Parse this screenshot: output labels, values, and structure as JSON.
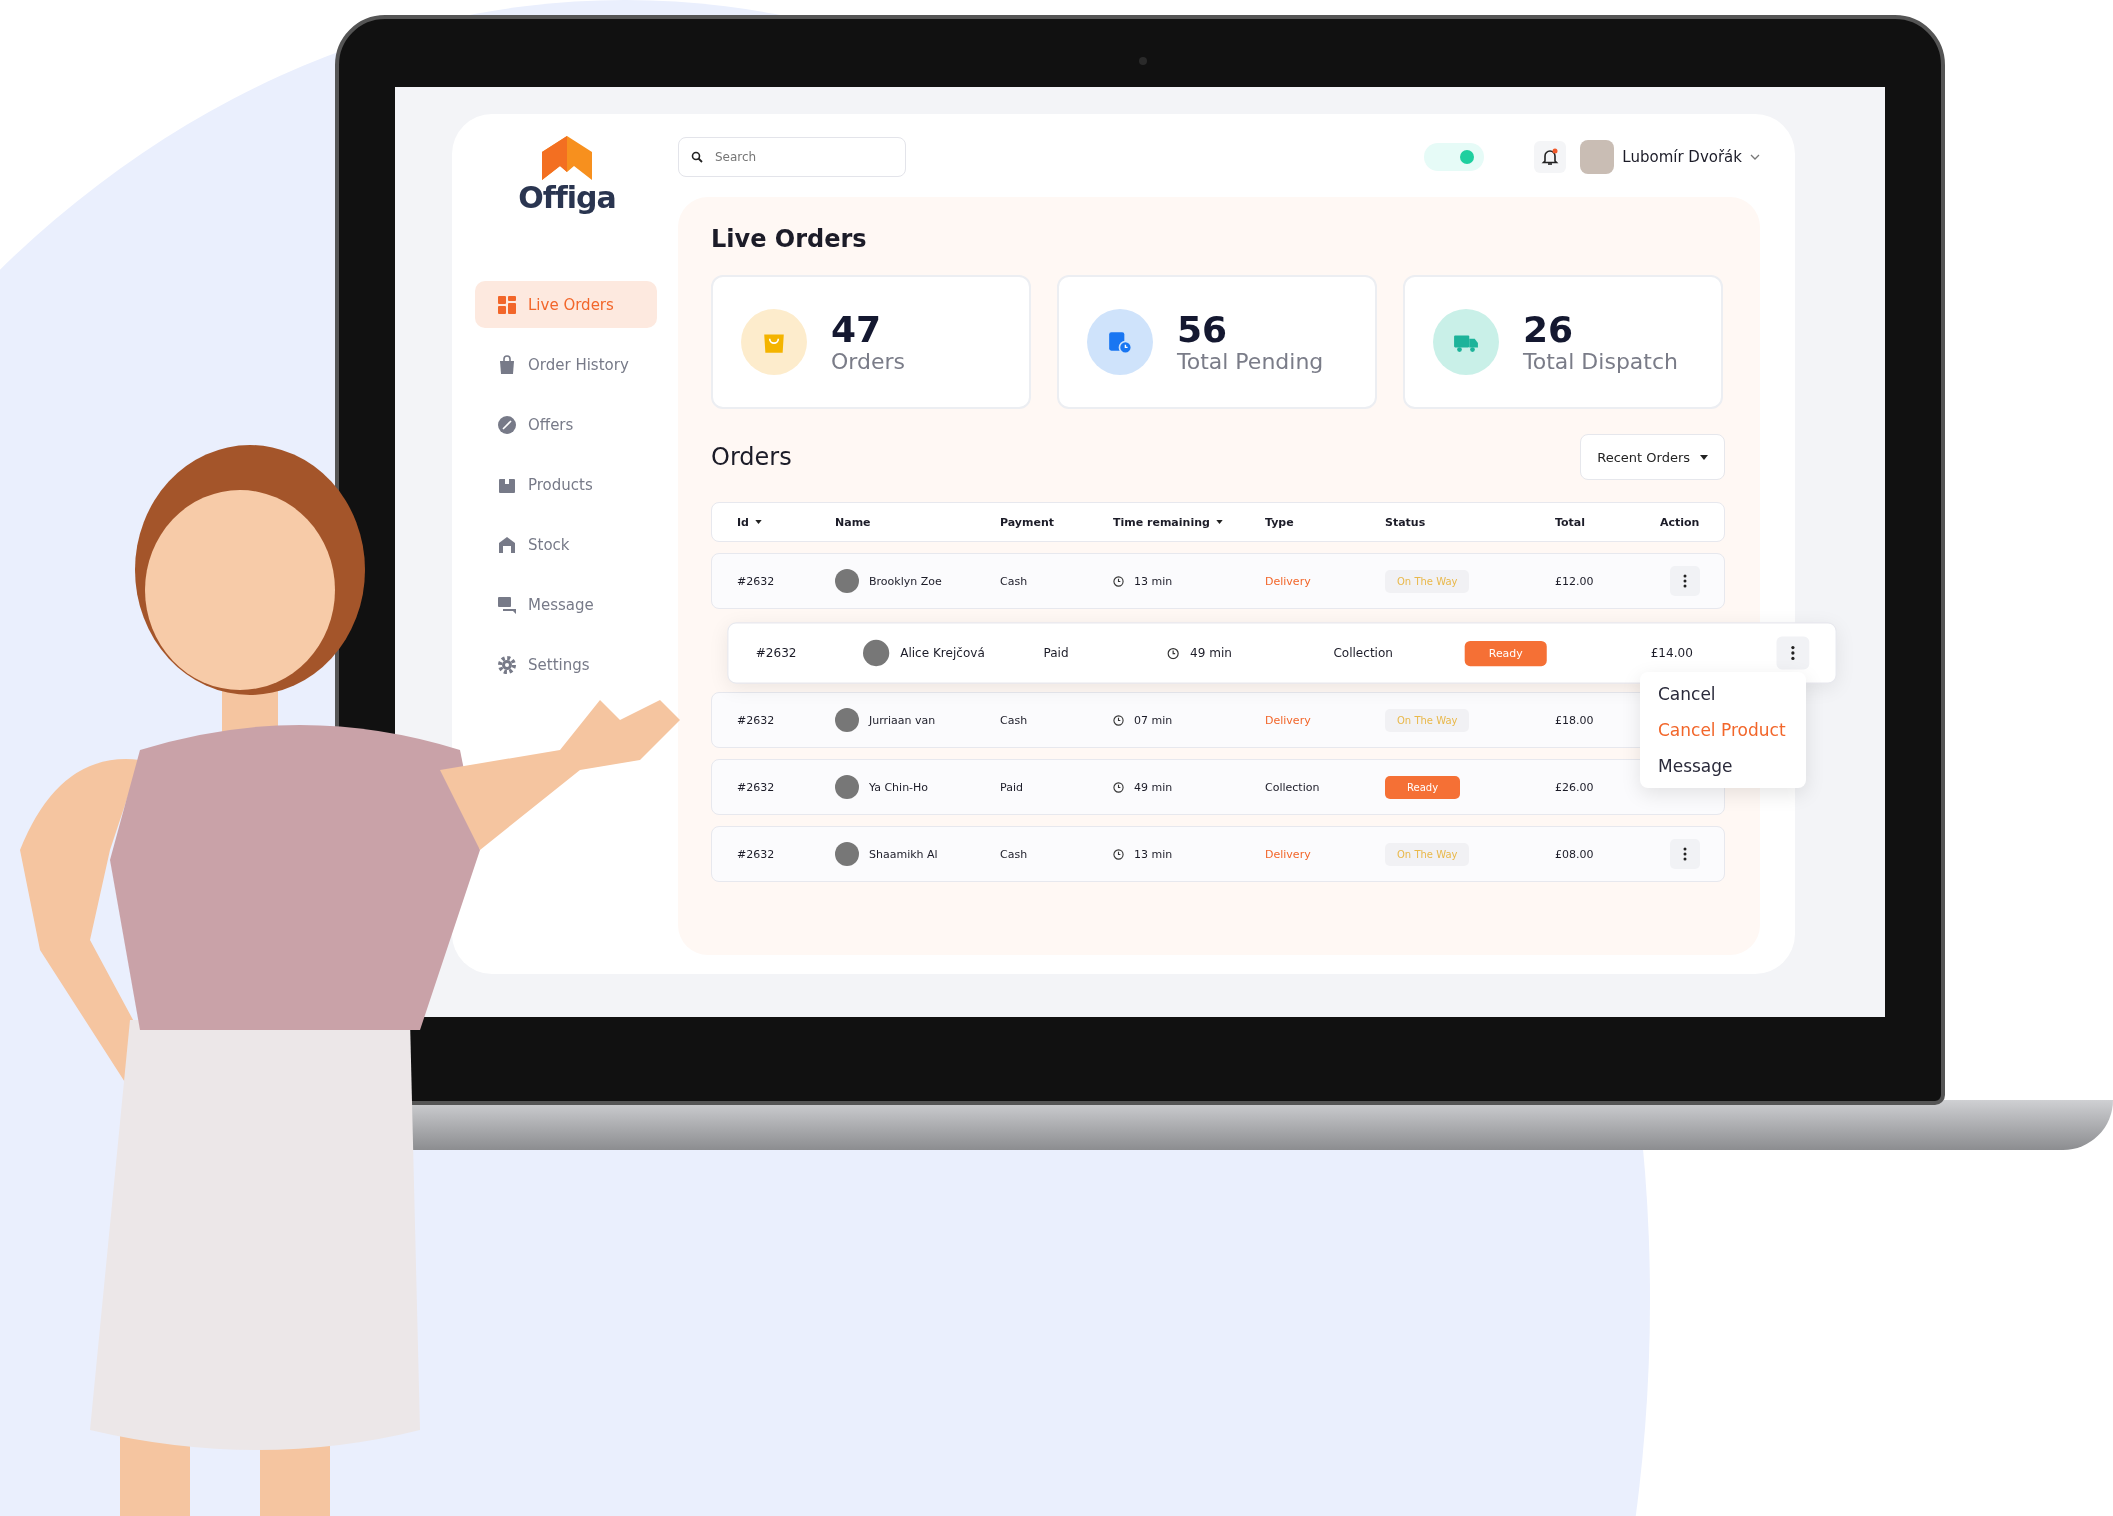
{
  "logo": {
    "text": "Offiga"
  },
  "search": {
    "placeholder": "Search"
  },
  "header": {
    "toggle_on": true,
    "user_name": "Lubomír Dvořák",
    "has_notification": true
  },
  "sidebar": {
    "items": [
      {
        "label": "Live Orders",
        "kind": "grid",
        "selected": true
      },
      {
        "label": "Order History",
        "kind": "bag",
        "selected": false
      },
      {
        "label": "Offers",
        "kind": "offer",
        "selected": false
      },
      {
        "label": "Products",
        "kind": "box",
        "selected": false
      },
      {
        "label": "Stock",
        "kind": "store",
        "selected": false
      },
      {
        "label": "Message",
        "kind": "chat",
        "selected": false
      },
      {
        "label": "Settings",
        "kind": "gear",
        "selected": false
      }
    ]
  },
  "page_title": "Live Orders",
  "stats": [
    {
      "value": "47",
      "label": "Orders",
      "kind": "orders"
    },
    {
      "value": "56",
      "label": "Total Pending",
      "kind": "pending"
    },
    {
      "value": "26",
      "label": "Total Dispatch",
      "kind": "dispatch"
    }
  ],
  "orders": {
    "title": "Orders",
    "filter": "Recent Orders",
    "columns": [
      {
        "label": "Id",
        "sortable": true
      },
      {
        "label": "Name",
        "sortable": false
      },
      {
        "label": "Payment",
        "sortable": false
      },
      {
        "label": "Time remaining",
        "sortable": true
      },
      {
        "label": "Type",
        "sortable": false
      },
      {
        "label": "Status",
        "sortable": false
      },
      {
        "label": "Total",
        "sortable": false
      },
      {
        "label": "Action",
        "sortable": false
      }
    ],
    "rows": [
      {
        "id": "#2632",
        "name": "Brooklyn Zoe",
        "payment": "Cash",
        "time": "13 min",
        "type": "Delivery",
        "type_accent": true,
        "status": "On The Way",
        "status_filled": false,
        "total": "£12.00",
        "highlighted": false,
        "show_action": true
      },
      {
        "id": "#2632",
        "name": "Alice Krejčová",
        "payment": "Paid",
        "time": "49 min",
        "type": "Collection",
        "type_accent": false,
        "status": "Ready",
        "status_filled": true,
        "total": "£14.00",
        "highlighted": true,
        "show_action": true
      },
      {
        "id": "#2632",
        "name": "Jurriaan van",
        "payment": "Cash",
        "time": "07 min",
        "type": "Delivery",
        "type_accent": true,
        "status": "On The Way",
        "status_filled": false,
        "total": "£18.00",
        "highlighted": false,
        "show_action": false
      },
      {
        "id": "#2632",
        "name": "Ya Chin-Ho",
        "payment": "Paid",
        "time": "49 min",
        "type": "Collection",
        "type_accent": false,
        "status": "Ready",
        "status_filled": true,
        "total": "£26.00",
        "highlighted": false,
        "show_action": false
      },
      {
        "id": "#2632",
        "name": "Shaamikh Al",
        "payment": "Cash",
        "time": "13 min",
        "type": "Delivery",
        "type_accent": true,
        "status": "On The Way",
        "status_filled": false,
        "total": "£08.00",
        "highlighted": false,
        "show_action": true
      }
    ],
    "action_menu": [
      {
        "label": "Cancel",
        "selected": false
      },
      {
        "label": "Cancel Product",
        "selected": true
      },
      {
        "label": "Message",
        "selected": false
      }
    ]
  }
}
